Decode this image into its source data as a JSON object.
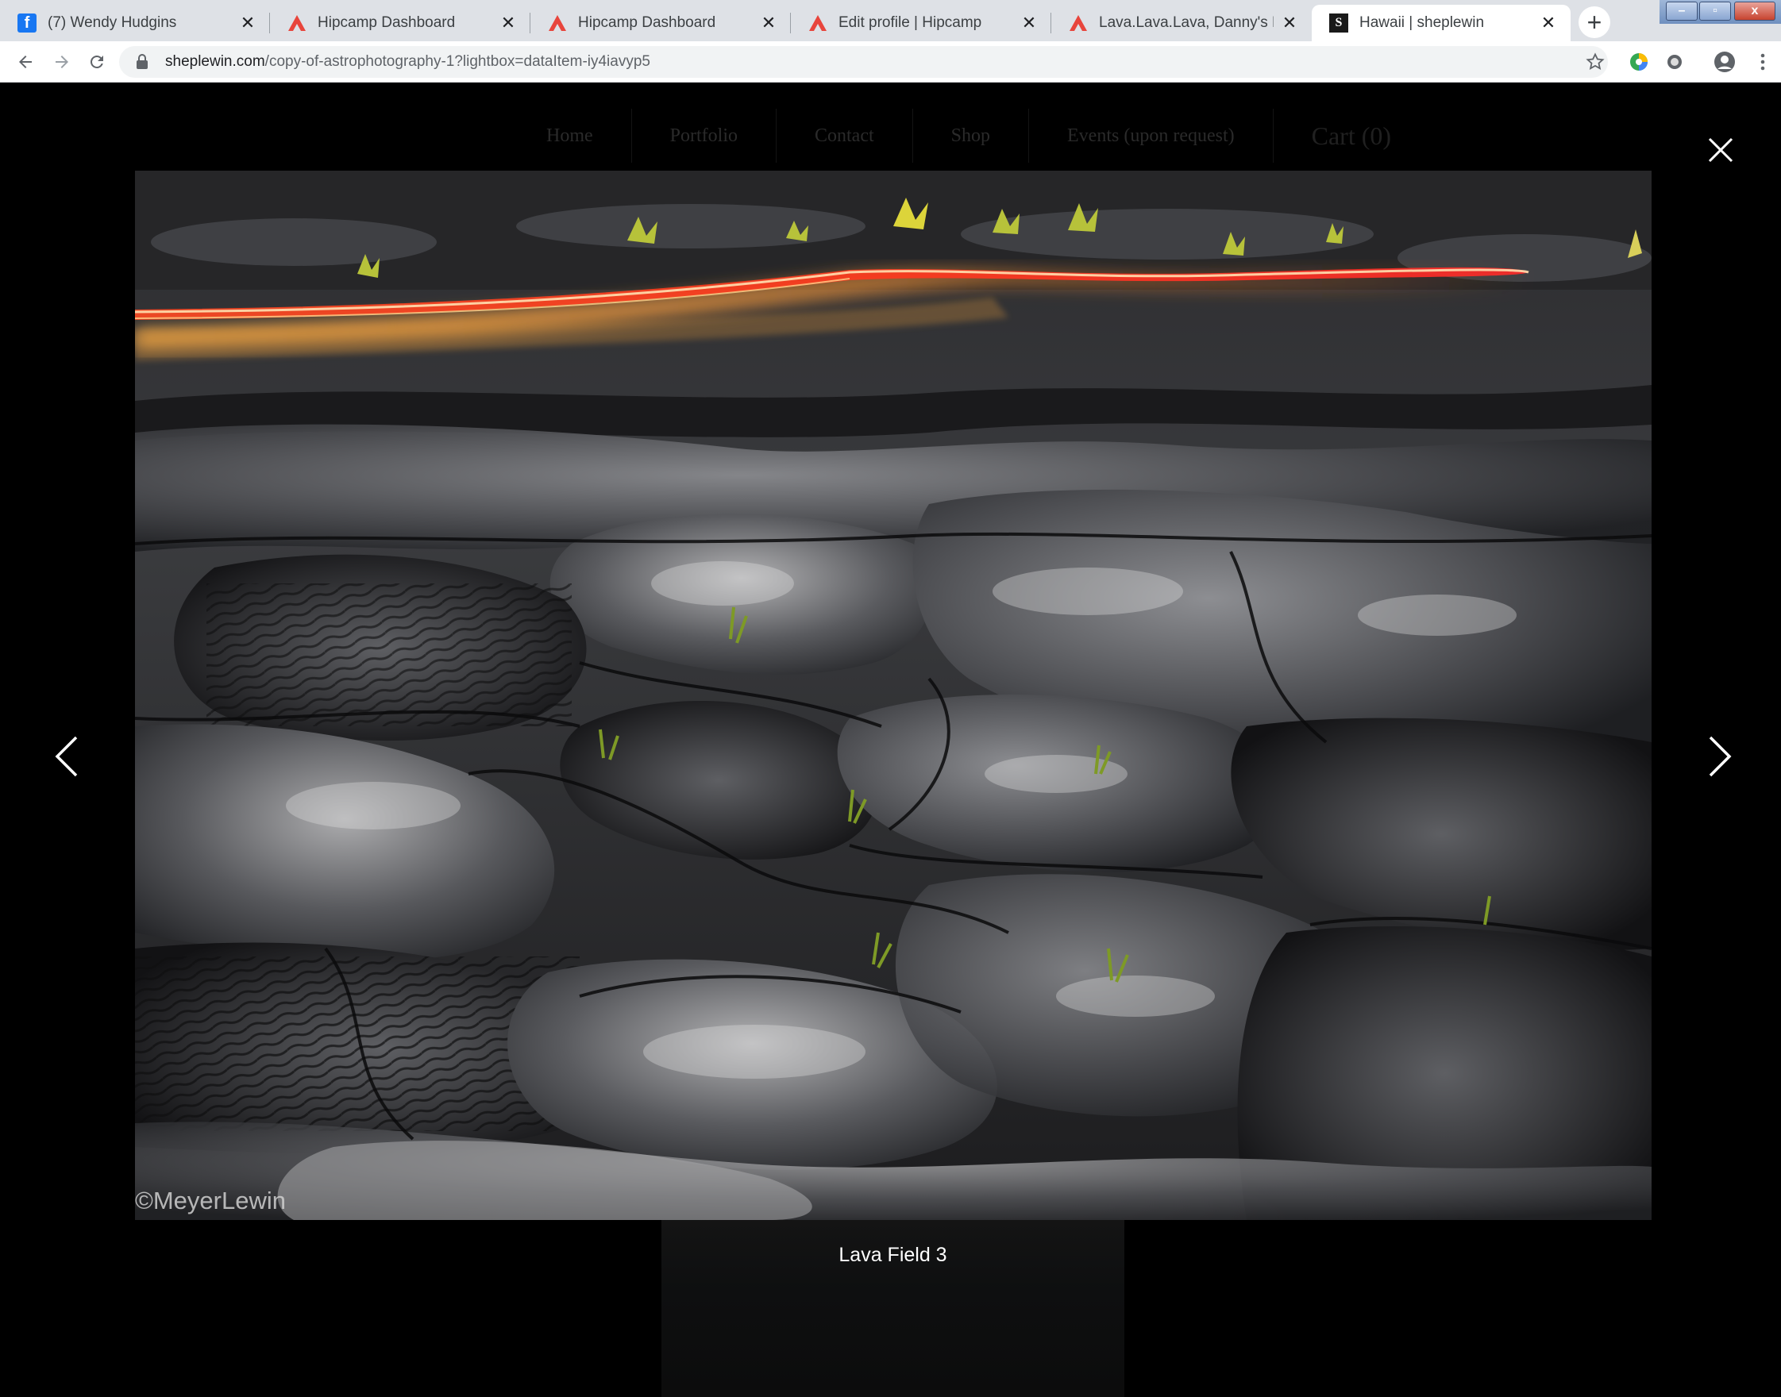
{
  "browser": {
    "tabs": [
      {
        "title": "(7) Wendy Hudgins",
        "icon": "facebook-icon",
        "active": false
      },
      {
        "title": "Hipcamp Dashboard",
        "icon": "hipcamp-icon",
        "active": false
      },
      {
        "title": "Hipcamp Dashboard",
        "icon": "hipcamp-icon",
        "active": false
      },
      {
        "title": "Edit profile | Hipcamp",
        "icon": "hipcamp-icon",
        "active": false
      },
      {
        "title": "Lava.Lava.Lava, Danny's Lava.Lav",
        "icon": "hipcamp-icon",
        "active": false
      },
      {
        "title": "Hawaii | sheplewin",
        "icon": "site-icon",
        "active": true
      }
    ],
    "url_host": "sheplewin.com",
    "url_path": "/copy-of-astrophotography-1?lightbox=dataItem-iy4iavyp5",
    "colors": {
      "hipcamp": "#e8453c",
      "facebook": "#1877f2"
    }
  },
  "site": {
    "nav": [
      "Home",
      "Portfolio",
      "Contact",
      "Shop",
      "Events (upon request)",
      "Cart (0)"
    ]
  },
  "lightbox": {
    "watermark": "©MeyerLewin",
    "caption": "Lava Field 3"
  }
}
